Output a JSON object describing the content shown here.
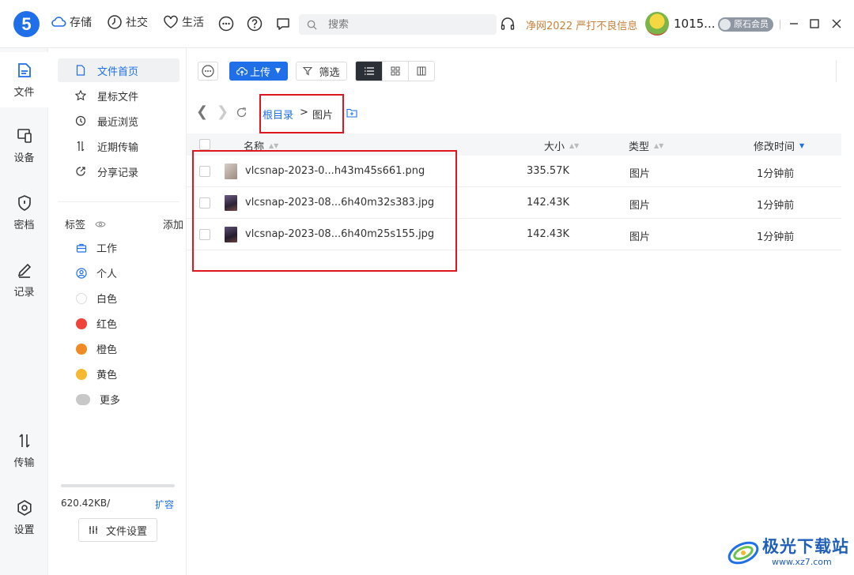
{
  "app": {
    "logo_text": "5",
    "nav": [
      {
        "icon": "cloud-icon",
        "label": "存储"
      },
      {
        "icon": "clock-icon",
        "label": "社交"
      },
      {
        "icon": "heart-icon",
        "label": "生活"
      }
    ],
    "search_placeholder": "搜索",
    "promo": "净网2022 严打不良信息",
    "username": "1015...",
    "vip_badge": "原石会员",
    "accent_color": "#1e6fe8"
  },
  "rail": [
    {
      "icon": "files-icon",
      "label": "文件",
      "active": true
    },
    {
      "icon": "device-icon",
      "label": "设备"
    },
    {
      "icon": "shield-icon",
      "label": "密档"
    },
    {
      "icon": "pen-icon",
      "label": "记录"
    },
    {
      "icon": "transfer-icon",
      "label": "传输"
    },
    {
      "icon": "gear-icon",
      "label": "设置"
    }
  ],
  "sidebar": {
    "items": [
      {
        "icon": "file-icon",
        "label": "文件首页",
        "active": true
      },
      {
        "icon": "star-icon",
        "label": "星标文件"
      },
      {
        "icon": "history-icon",
        "label": "最近浏览"
      },
      {
        "icon": "transfer-icon",
        "label": "近期传输"
      },
      {
        "icon": "share-icon",
        "label": "分享记录"
      }
    ],
    "tags_header": "标签",
    "tags_add": "添加",
    "tags": [
      {
        "label": "工作",
        "icon": "briefcase-icon"
      },
      {
        "label": "个人",
        "icon": "person-icon"
      },
      {
        "label": "白色",
        "color": "#ffffff"
      },
      {
        "label": "红色",
        "color": "#f0433a"
      },
      {
        "label": "橙色",
        "color": "#f08a24"
      },
      {
        "label": "黄色",
        "color": "#f5b82e"
      },
      {
        "label": "更多",
        "color": "#c8c8c8"
      }
    ],
    "storage_used": "620.42KB/",
    "expand": "扩容",
    "settings_button": "文件设置"
  },
  "toolbar": {
    "upload": "上传",
    "filter": "筛选"
  },
  "path": {
    "root": "根目录",
    "separator": ">",
    "current": "图片"
  },
  "table": {
    "headers": {
      "name": "名称",
      "size": "大小",
      "type": "类型",
      "modified": "修改时间"
    },
    "rows": [
      {
        "name": "vlcsnap-2023-0...h43m45s661.png",
        "size": "335.57K",
        "type": "图片",
        "modified": "1分钟前",
        "thumb_color": "#b8a8a0"
      },
      {
        "name": "vlcsnap-2023-08...6h40m32s383.jpg",
        "size": "142.43K",
        "type": "图片",
        "modified": "1分钟前",
        "thumb_color": "#4a3d5c"
      },
      {
        "name": "vlcsnap-2023-08...6h40m25s155.jpg",
        "size": "142.43K",
        "type": "图片",
        "modified": "1分钟前",
        "thumb_color": "#3e3550"
      }
    ]
  },
  "watermark": {
    "title": "极光下载站",
    "url": "www.xz7.com"
  }
}
